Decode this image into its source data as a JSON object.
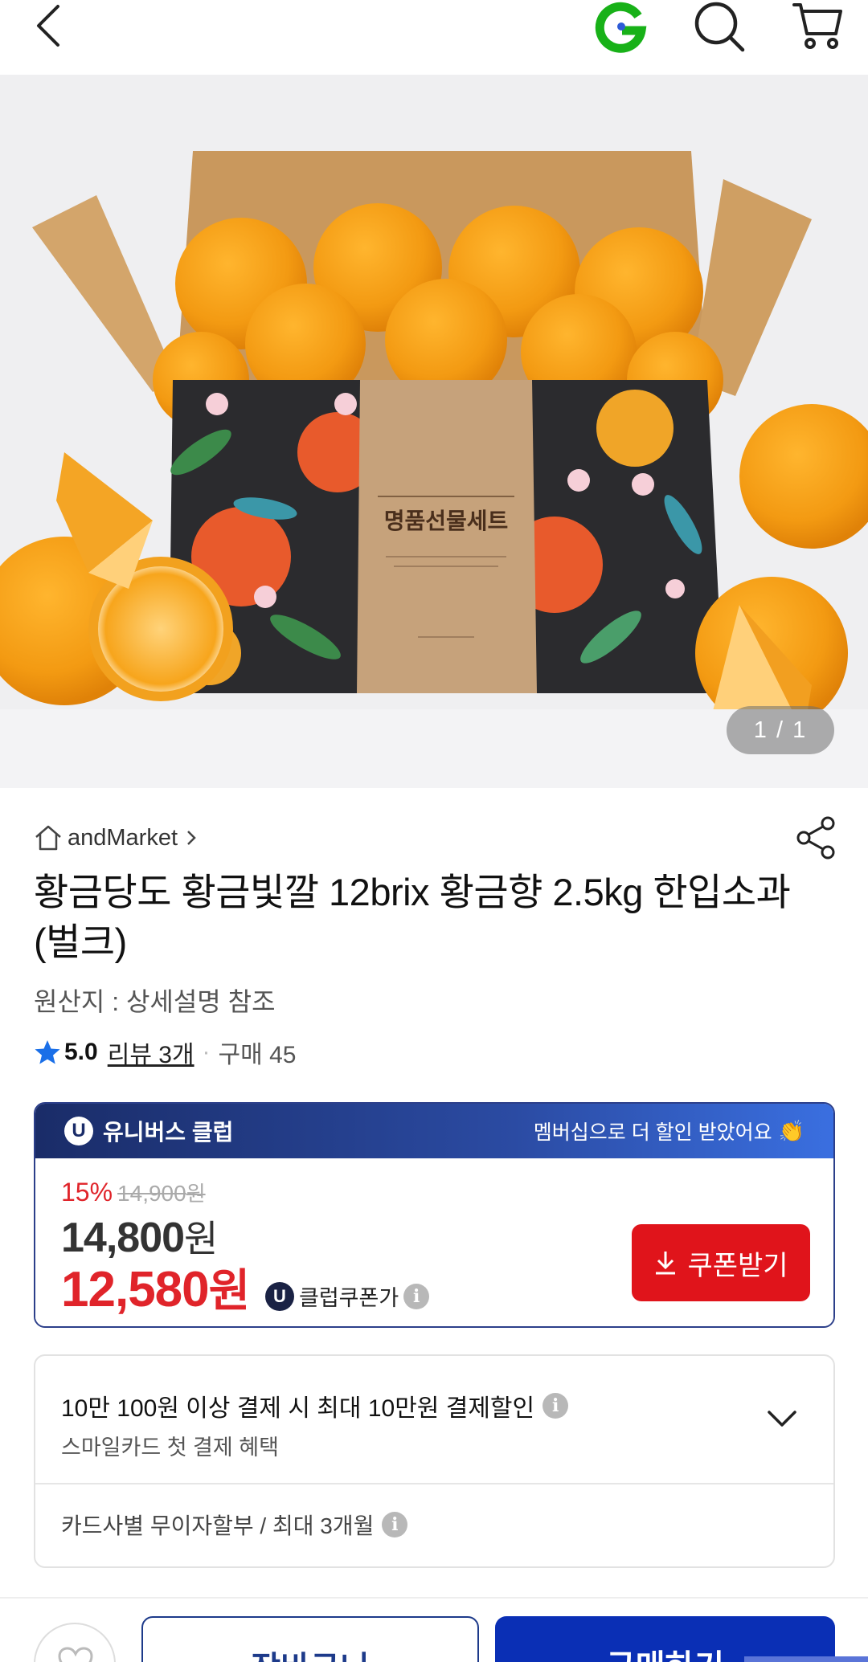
{
  "header": {
    "icons": [
      "back-arrow-icon",
      "gmarket-g-logo",
      "search-icon",
      "cart-icon"
    ],
    "logo_color": "#18b118"
  },
  "hero": {
    "counter": "1 / 1",
    "box_label": "명품선물세트"
  },
  "store": {
    "name": "andMarket"
  },
  "product": {
    "title": "황금당도 황금빛깔 12brix 황금향 2.5kg 한입소과(벌크)",
    "origin": "원산지 : 상세설명 참조",
    "rating": "5.0",
    "review_link": "리뷰 3개",
    "separator": "·",
    "purchases": "구매 45"
  },
  "club": {
    "badge_letter": "U",
    "label": "유니버스 클럽",
    "promo_text": "멤버십으로 더 할인 받았어요",
    "promo_emoji": "👏",
    "discount_pct": "15%",
    "original_price": "14,900",
    "original_unit": "원",
    "price": "14,800",
    "price_unit": "원",
    "club_price": "12,580",
    "club_price_unit": "원",
    "club_tag": "클럽쿠폰가",
    "info_symbol": "i",
    "coupon_button": "쿠폰받기",
    "accent_color": "#e0242a",
    "header_color": "#1a2c68"
  },
  "payment": {
    "main_text": "10만 100원 이상 결제 시 최대 10만원 결제할인",
    "sub_text": "스마일카드 첫 결제 혜택",
    "installment_text": "카드사별 무이자할부 / 최대 3개월"
  },
  "actions": {
    "cart_button": "장바구니",
    "buy_button": "구매하기",
    "buy_color": "#0a2fb5"
  }
}
